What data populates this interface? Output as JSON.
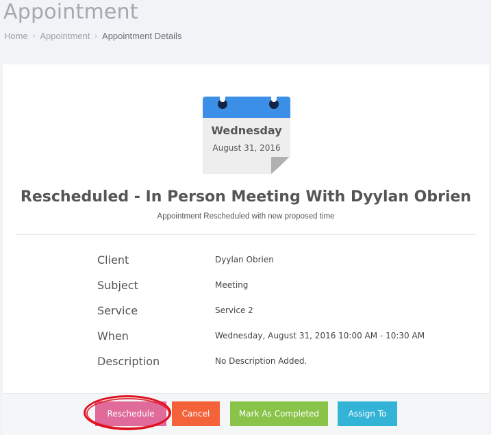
{
  "header": {
    "title": "Appointment",
    "breadcrumb": [
      {
        "label": "Home"
      },
      {
        "label": "Appointment"
      },
      {
        "label": "Appointment Details"
      }
    ]
  },
  "calendar": {
    "day": "Wednesday",
    "date": "August 31, 2016",
    "accent_color": "#3c8fe6"
  },
  "appointment": {
    "title": "Rescheduled - In Person Meeting With Dyylan Obrien",
    "subtitle": "Appointment Rescheduled with new proposed time",
    "details": [
      {
        "label": "Client",
        "value": "Dyylan Obrien"
      },
      {
        "label": "Subject",
        "value": "Meeting"
      },
      {
        "label": "Service",
        "value": "Service 2"
      },
      {
        "label": "When",
        "value": "Wednesday, August 31, 2016 10:00 AM - 10:30 AM"
      },
      {
        "label": "Description",
        "value": "No Description Added."
      }
    ]
  },
  "actions": {
    "reschedule": {
      "label": "Reschedule",
      "color": "#e06b9a"
    },
    "cancel": {
      "label": "Cancel",
      "color": "#f4623a"
    },
    "complete": {
      "label": "Mark As Completed",
      "color": "#8ac34a"
    },
    "assign": {
      "label": "Assign To",
      "color": "#33b4d6"
    }
  },
  "icons": [
    "chevron-right-icon",
    "calendar-icon"
  ],
  "annotation_color": "#e0101c"
}
